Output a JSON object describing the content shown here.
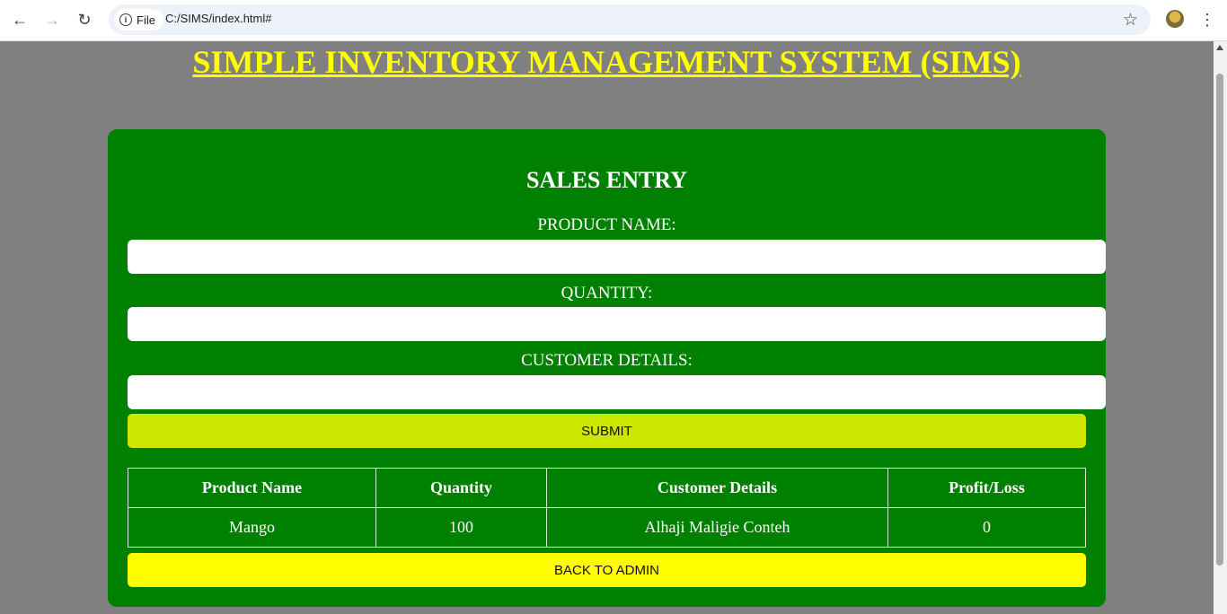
{
  "browser": {
    "scheme_label": "File",
    "url": "C:/SIMS/index.html#"
  },
  "page": {
    "title": "SIMPLE INVENTORY MANAGEMENT SYSTEM (SIMS)"
  },
  "form": {
    "heading": "SALES ENTRY",
    "fields": {
      "product_name": {
        "label": "PRODUCT NAME:",
        "value": ""
      },
      "quantity": {
        "label": "QUANTITY:",
        "value": ""
      },
      "customer_details": {
        "label": "CUSTOMER DETAILS:",
        "value": ""
      }
    },
    "submit_label": "SUBMIT"
  },
  "table": {
    "headers": [
      "Product Name",
      "Quantity",
      "Customer Details",
      "Profit/Loss"
    ],
    "rows": [
      [
        "Mango",
        "100",
        "Alhaji Maligie Conteh",
        "0"
      ]
    ]
  },
  "back_label": "BACK TO ADMIN",
  "colors": {
    "page_bg": "#808080",
    "panel_bg": "#008000",
    "title": "#ffff00",
    "submit_bg": "#cde600",
    "back_bg": "#ffff00"
  }
}
